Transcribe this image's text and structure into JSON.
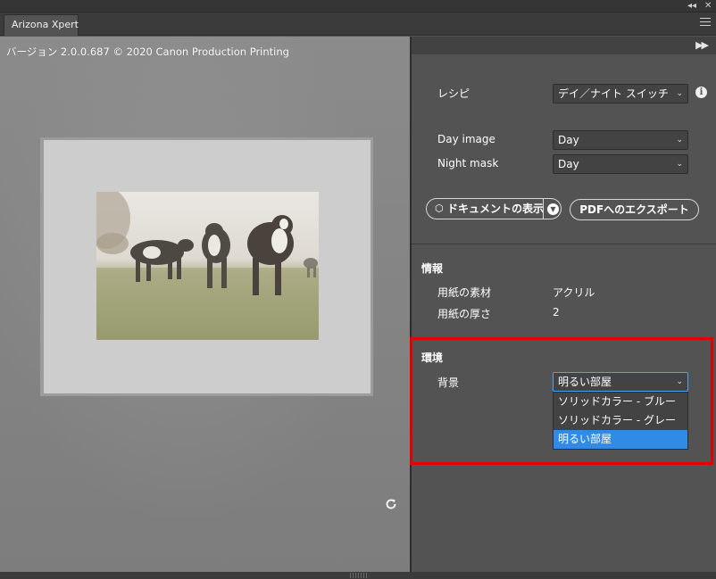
{
  "window": {
    "collapse_icon": "double-chevron-left-icon",
    "close_icon": "close-icon"
  },
  "tab": {
    "label": "Arizona Xpert"
  },
  "tab_menu_icon": "hamburger-icon",
  "preview": {
    "version_text": "バージョン 2.0.0.687 © 2020 Canon Production Printing",
    "image_description": "cows-in-pasture-photo",
    "rotate_icon": "rotate-icon"
  },
  "panel": {
    "expand_icon": "double-chevron-right-icon",
    "recipe": {
      "label": "レシピ",
      "value": "デイ／ナイト スイッチ"
    },
    "day_image": {
      "label": "Day image",
      "value": "Day"
    },
    "night_mask": {
      "label": "Night mask",
      "value": "Day"
    },
    "show_document_button": "ドキュメントの表示",
    "export_pdf_button": "PDFへのエクスポート",
    "info": {
      "title": "情報",
      "material_label": "用紙の素材",
      "material_value": "アクリル",
      "thickness_label": "用紙の厚さ",
      "thickness_value": "2"
    },
    "environment": {
      "title": "環境",
      "background_label": "背景",
      "background_value": "明るい部屋",
      "options": [
        "ソリッドカラー - ブルー",
        "ソリッドカラー - グレー",
        "明るい部屋"
      ],
      "selected_index": 2
    }
  },
  "colors": {
    "panel_bg": "#535353",
    "selection": "#2f8be6",
    "highlight_border": "#e00000"
  }
}
